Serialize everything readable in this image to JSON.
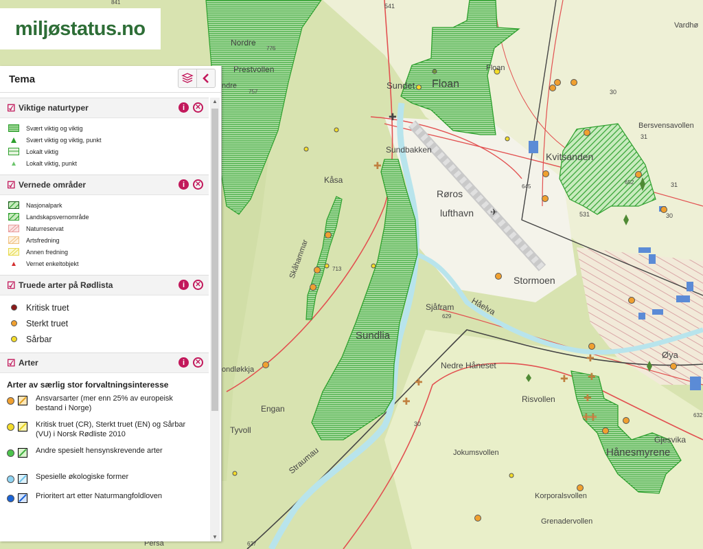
{
  "logo": {
    "text": "miljøstatus.no"
  },
  "panel": {
    "title": "Tema",
    "sections": {
      "naturtyper": {
        "title": "Viktige naturtyper",
        "items": [
          "Svært viktig og viktig",
          "Svært viktig og viktig, punkt",
          "Lokalt viktig",
          "Lokalt viktig, punkt"
        ]
      },
      "vernede": {
        "title": "Vernede områder",
        "items": [
          "Nasjonalpark",
          "Landskapsvernområde",
          "Naturreservat",
          "Artsfredning",
          "Annen fredning",
          "Vernet enkeltobjekt"
        ]
      },
      "rodlista": {
        "title": "Truede arter på Rødlista",
        "items": [
          "Kritisk truet",
          "Sterkt truet",
          "Sårbar"
        ]
      },
      "arter": {
        "title": "Arter",
        "subtitle": "Arter av særlig stor forvaltningsinteresse",
        "items": [
          "Ansvarsarter (mer enn 25% av europeisk bestand i Norge)",
          "Kritisk truet (CR), Sterkt truet (EN) og Sårbar (VU) i Norsk Rødliste 2010",
          "Andre spesielt hensynskrevende arter",
          "Spesielle økologiske former",
          "Prioritert art etter Naturmangfoldloven"
        ]
      }
    }
  },
  "map": {
    "labels": {
      "nordre": "Nordre",
      "prestvollen": "Prestvollen",
      "sundet": "Sundet",
      "floan_small": "Floan",
      "floan": "Floan",
      "sundbakken": "Sundbakken",
      "kasa": "Kåsa",
      "roros": "Røros",
      "lufthavn": "lufthavn",
      "kvitsanden": "Kvitsanden",
      "bersvensavollen": "Bersvensavollen",
      "stormoen": "Stormoen",
      "sjafram": "Sjåfram",
      "haelva": "Håelva",
      "sundlia": "Sundlia",
      "nedre_haneset": "Nedre Håneset",
      "oya": "Øya",
      "risvollen": "Risvollen",
      "gjesvika": "Gjesvika",
      "hanesmyrene": "Hånesmyrene",
      "jokumsvollen": "Jokumsvollen",
      "korporalsvollen": "Korporalsvollen",
      "grenadervollen": "Grenadervollen",
      "engan": "Engan",
      "tyvoll": "Tyvoll",
      "straumau": "Straumau",
      "skaharnmar": "Skåhammar",
      "ondlokkja": "ondløkkja",
      "persa": "Persa",
      "vardho": "Vardhø",
      "ndre": "ndre",
      "r541": "541",
      "r30a": "30",
      "r30b": "30",
      "r30c": "30",
      "r31a": "31",
      "r31b": "31",
      "r531": "531",
      "e757": "757",
      "e713": "713",
      "e629": "629",
      "e645": "645",
      "e652": "652",
      "e776": "776",
      "e632": "632",
      "e841": "841",
      "e627": "627"
    }
  },
  "colors": {
    "brand_green": "#2e6e37",
    "accent_magenta": "#c2185b",
    "protected_green": "#2ea02e",
    "forest": "#d8e3b0",
    "river": "#b8e4ec",
    "road": "#e25050",
    "kritisk": "#8b1a1a",
    "sterkt": "#f0a030",
    "sarbar": "#f3dc2a"
  }
}
